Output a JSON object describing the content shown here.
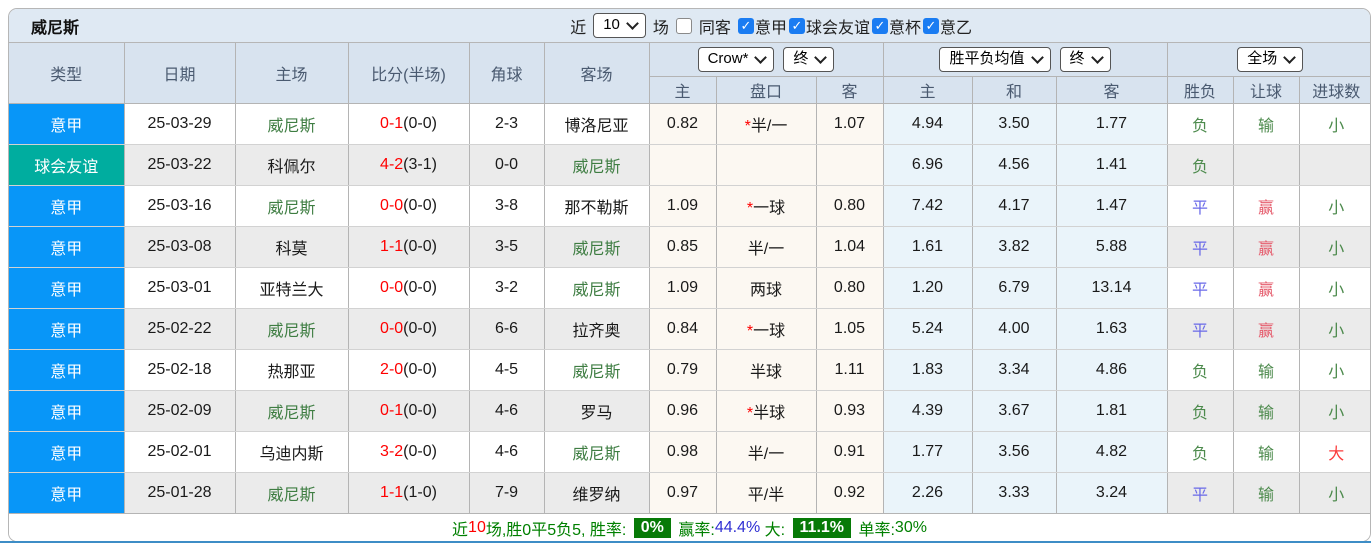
{
  "topbar": {
    "title": "威尼斯",
    "near_label": "近",
    "near_count": "10",
    "unit_label": "场",
    "same_away": {
      "label": "同客",
      "checked": false
    },
    "filters": [
      {
        "label": "意甲",
        "checked": true
      },
      {
        "label": "球会友谊",
        "checked": true
      },
      {
        "label": "意杯",
        "checked": true
      },
      {
        "label": "意乙",
        "checked": true
      }
    ]
  },
  "table": {
    "headers": [
      "类型",
      "日期",
      "主场",
      "比分(半场)",
      "角球",
      "客场"
    ],
    "selects": {
      "source": "Crow*",
      "source_time": "终",
      "avg": "胜平负均值",
      "avg_time": "终",
      "scope": "全场"
    },
    "sub_headers": [
      "主",
      "盘口",
      "客",
      "主",
      "和",
      "客",
      "胜负",
      "让球",
      "进球数"
    ],
    "rows": [
      {
        "league": "意甲",
        "league_type": "league",
        "date": "25-03-29",
        "home": "威尼斯",
        "home_is_team": true,
        "score": "0-1",
        "half": "(0-0)",
        "corners": "2-3",
        "away": "博洛尼亚",
        "away_is_team": false,
        "odds_home": "0.82",
        "handicap": "半/一",
        "handicap_star": true,
        "odds_away": "1.07",
        "avg_home": "4.94",
        "avg_draw": "3.50",
        "avg_away": "1.77",
        "result": "负",
        "result_color": "green",
        "handicap_result": "输",
        "handicap_result_color": "green",
        "goals": "小",
        "goals_color": "green"
      },
      {
        "league": "球会友谊",
        "league_type": "friendly",
        "date": "25-03-22",
        "home": "科佩尔",
        "home_is_team": false,
        "score": "4-2",
        "half": "(3-1)",
        "corners": "0-0",
        "away": "威尼斯",
        "away_is_team": true,
        "odds_home": "",
        "handicap": "",
        "handicap_star": false,
        "odds_away": "",
        "avg_home": "6.96",
        "avg_draw": "4.56",
        "avg_away": "1.41",
        "result": "负",
        "result_color": "green",
        "handicap_result": "",
        "handicap_result_color": "green",
        "goals": "",
        "goals_color": "green"
      },
      {
        "league": "意甲",
        "league_type": "league",
        "date": "25-03-16",
        "home": "威尼斯",
        "home_is_team": true,
        "score": "0-0",
        "half": "(0-0)",
        "corners": "3-8",
        "away": "那不勒斯",
        "away_is_team": false,
        "odds_home": "1.09",
        "handicap": "一球",
        "handicap_star": true,
        "odds_away": "0.80",
        "avg_home": "7.42",
        "avg_draw": "4.17",
        "avg_away": "1.47",
        "result": "平",
        "result_color": "blue",
        "handicap_result": "赢",
        "handicap_result_color": "pink",
        "goals": "小",
        "goals_color": "green"
      },
      {
        "league": "意甲",
        "league_type": "league",
        "date": "25-03-08",
        "home": "科莫",
        "home_is_team": false,
        "score": "1-1",
        "half": "(0-0)",
        "corners": "3-5",
        "away": "威尼斯",
        "away_is_team": true,
        "odds_home": "0.85",
        "handicap": "半/一",
        "handicap_star": false,
        "odds_away": "1.04",
        "avg_home": "1.61",
        "avg_draw": "3.82",
        "avg_away": "5.88",
        "result": "平",
        "result_color": "blue",
        "handicap_result": "赢",
        "handicap_result_color": "pink",
        "goals": "小",
        "goals_color": "green"
      },
      {
        "league": "意甲",
        "league_type": "league",
        "date": "25-03-01",
        "home": "亚特兰大",
        "home_is_team": false,
        "score": "0-0",
        "half": "(0-0)",
        "corners": "3-2",
        "away": "威尼斯",
        "away_is_team": true,
        "odds_home": "1.09",
        "handicap": "两球",
        "handicap_star": false,
        "odds_away": "0.80",
        "avg_home": "1.20",
        "avg_draw": "6.79",
        "avg_away": "13.14",
        "result": "平",
        "result_color": "blue",
        "handicap_result": "赢",
        "handicap_result_color": "pink",
        "goals": "小",
        "goals_color": "green"
      },
      {
        "league": "意甲",
        "league_type": "league",
        "date": "25-02-22",
        "home": "威尼斯",
        "home_is_team": true,
        "score": "0-0",
        "half": "(0-0)",
        "corners": "6-6",
        "away": "拉齐奥",
        "away_is_team": false,
        "odds_home": "0.84",
        "handicap": "一球",
        "handicap_star": true,
        "odds_away": "1.05",
        "avg_home": "5.24",
        "avg_draw": "4.00",
        "avg_away": "1.63",
        "result": "平",
        "result_color": "blue",
        "handicap_result": "赢",
        "handicap_result_color": "pink",
        "goals": "小",
        "goals_color": "green"
      },
      {
        "league": "意甲",
        "league_type": "league",
        "date": "25-02-18",
        "home": "热那亚",
        "home_is_team": false,
        "score": "2-0",
        "half": "(0-0)",
        "corners": "4-5",
        "away": "威尼斯",
        "away_is_team": true,
        "odds_home": "0.79",
        "handicap": "半球",
        "handicap_star": false,
        "odds_away": "1.11",
        "avg_home": "1.83",
        "avg_draw": "3.34",
        "avg_away": "4.86",
        "result": "负",
        "result_color": "green",
        "handicap_result": "输",
        "handicap_result_color": "green",
        "goals": "小",
        "goals_color": "green"
      },
      {
        "league": "意甲",
        "league_type": "league",
        "date": "25-02-09",
        "home": "威尼斯",
        "home_is_team": true,
        "score": "0-1",
        "half": "(0-0)",
        "corners": "4-6",
        "away": "罗马",
        "away_is_team": false,
        "odds_home": "0.96",
        "handicap": "半球",
        "handicap_star": true,
        "odds_away": "0.93",
        "avg_home": "4.39",
        "avg_draw": "3.67",
        "avg_away": "1.81",
        "result": "负",
        "result_color": "green",
        "handicap_result": "输",
        "handicap_result_color": "green",
        "goals": "小",
        "goals_color": "green"
      },
      {
        "league": "意甲",
        "league_type": "league",
        "date": "25-02-01",
        "home": "乌迪内斯",
        "home_is_team": false,
        "score": "3-2",
        "half": "(0-0)",
        "corners": "4-6",
        "away": "威尼斯",
        "away_is_team": true,
        "odds_home": "0.98",
        "handicap": "半/一",
        "handicap_star": false,
        "odds_away": "0.91",
        "avg_home": "1.77",
        "avg_draw": "3.56",
        "avg_away": "4.82",
        "result": "负",
        "result_color": "green",
        "handicap_result": "输",
        "handicap_result_color": "green",
        "goals": "大",
        "goals_color": "red"
      },
      {
        "league": "意甲",
        "league_type": "league",
        "date": "25-01-28",
        "home": "威尼斯",
        "home_is_team": true,
        "score": "1-1",
        "half": "(1-0)",
        "corners": "7-9",
        "away": "维罗纳",
        "away_is_team": false,
        "odds_home": "0.97",
        "handicap": "平/半",
        "handicap_star": false,
        "odds_away": "0.92",
        "avg_home": "2.26",
        "avg_draw": "3.33",
        "avg_away": "3.24",
        "result": "平",
        "result_color": "blue",
        "handicap_result": "输",
        "handicap_result_color": "green",
        "goals": "小",
        "goals_color": "green"
      }
    ]
  },
  "footer": {
    "segments": [
      {
        "text": "近",
        "style": "green"
      },
      {
        "text": "10",
        "style": "red"
      },
      {
        "text": "场,胜0平5负5, 胜率: ",
        "style": "green"
      },
      {
        "text": "0%",
        "style": "badge"
      },
      {
        "text": " 赢率:",
        "style": "green"
      },
      {
        "text": "44.4%",
        "style": "blue"
      },
      {
        "text": " 大: ",
        "style": "green"
      },
      {
        "text": "11.1%",
        "style": "badge"
      },
      {
        "text": " 单率:",
        "style": "green"
      },
      {
        "text": "30%",
        "style": "green"
      }
    ]
  },
  "colors": {
    "league_badge": "#0896f8",
    "friendly_badge": "#00ad9f",
    "team_highlight_green": "#3e7d42",
    "score_red": "#ff0000",
    "result_green": "#4c8a4c",
    "result_blue": "#6a6ae8",
    "result_pink": "#e55c6c",
    "result_red": "#fb3b3b",
    "footer_green": "#008000",
    "footer_blue": "#2f2fd3",
    "badge_bg_green": "#077a07",
    "header_bg": "#d8e3ef",
    "topbar_bg": "#dfe9f3",
    "crow_col_bg": "#fcf8f2",
    "avg_col_bg": "#eaf4fa",
    "alt_row_bg": "#ebebeb",
    "checkbox_blue": "#1a7cf2",
    "bottom_line_blue": "#3d8dc6"
  }
}
